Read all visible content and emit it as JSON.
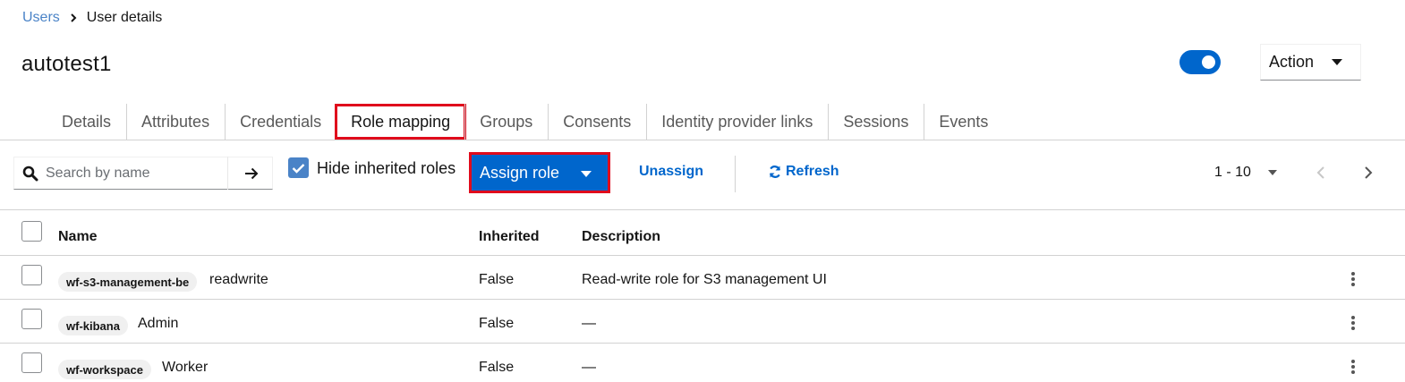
{
  "breadcrumb": {
    "parent": "Users",
    "current": "User details"
  },
  "page_title": "autotest1",
  "header": {
    "enabled": true,
    "action_label": "Action"
  },
  "tabs": [
    {
      "label": "Details",
      "active": false
    },
    {
      "label": "Attributes",
      "active": false
    },
    {
      "label": "Credentials",
      "active": false
    },
    {
      "label": "Role mapping",
      "active": true
    },
    {
      "label": "Groups",
      "active": false
    },
    {
      "label": "Consents",
      "active": false
    },
    {
      "label": "Identity provider links",
      "active": false
    },
    {
      "label": "Sessions",
      "active": false
    },
    {
      "label": "Events",
      "active": false
    }
  ],
  "toolbar": {
    "search_placeholder": "Search by name",
    "hide_inherited_label": "Hide inherited roles",
    "hide_inherited_checked": true,
    "assign_label": "Assign role",
    "unassign_label": "Unassign",
    "refresh_label": "Refresh",
    "pagination_range": "1 - 10"
  },
  "table": {
    "columns": [
      "Name",
      "Inherited",
      "Description"
    ],
    "rows": [
      {
        "client": "wf-s3-management-be",
        "role": "readwrite",
        "inherited": "False",
        "description": "Read-write role for S3 management UI"
      },
      {
        "client": "wf-kibana",
        "role": "Admin",
        "inherited": "False",
        "description": "—"
      },
      {
        "client": "wf-workspace",
        "role": "Worker",
        "inherited": "False",
        "description": "—"
      }
    ]
  },
  "colors": {
    "primary": "#0066cc",
    "link": "#4a83c7",
    "highlight": "#e00b1c",
    "border": "#d2d2d2"
  }
}
